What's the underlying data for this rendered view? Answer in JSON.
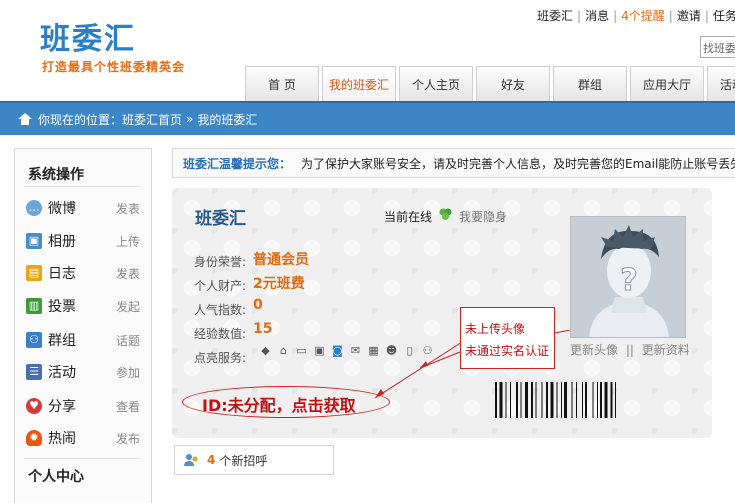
{
  "logo": {
    "title": "班委汇",
    "slogan": "打造最具个性班委精英会"
  },
  "toplinks": {
    "home": "班委汇",
    "messages": "消息",
    "alerts": "4个提醒",
    "invite": "邀请",
    "tasks": "任务"
  },
  "search": {
    "placeholder": "找班委"
  },
  "nav": {
    "tabs": [
      "首 页",
      "我的班委汇",
      "个人主页",
      "好友",
      "群组",
      "应用大厅",
      "活动中心"
    ],
    "active": "我的班委汇"
  },
  "breadcrumb": {
    "prefix": "你现在的位置：",
    "home": "班委汇首页",
    "sep": "»",
    "current": "我的班委汇"
  },
  "sidebar": {
    "section1": "系统操作",
    "items": [
      {
        "label": "微博",
        "action": "发表",
        "icon": "weibo-icon",
        "color": "#6aa7d8"
      },
      {
        "label": "相册",
        "action": "上传",
        "icon": "album-icon",
        "color": "#4c8ac9"
      },
      {
        "label": "日志",
        "action": "发表",
        "icon": "diary-icon",
        "color": "#e8a316"
      },
      {
        "label": "投票",
        "action": "发起",
        "icon": "vote-icon",
        "color": "#3a9b3a"
      },
      {
        "label": "群组",
        "action": "话题",
        "icon": "group-icon",
        "color": "#3a7fc8"
      },
      {
        "label": "活动",
        "action": "参加",
        "icon": "event-icon",
        "color": "#4a6fb0"
      },
      {
        "label": "分享",
        "action": "查看",
        "icon": "share-icon",
        "color": "#d43a3a"
      },
      {
        "label": "热闹",
        "action": "发布",
        "icon": "hot-icon",
        "color": "#e85a14"
      }
    ],
    "section2": "个人中心"
  },
  "notice": {
    "title": "班委汇温馨提示您：",
    "body": "为了保护大家账号安全，请及时完善个人信息，及时完善您的Email能防止账号丢失"
  },
  "profile": {
    "username": "班委汇",
    "online": "当前在线",
    "hide": "我要隐身",
    "fields": [
      {
        "label": "身份荣誉:",
        "value": "普通会员"
      },
      {
        "label": "个人财产:",
        "value": "2元班费"
      },
      {
        "label": "人气指数:",
        "value": "0"
      },
      {
        "label": "经验数值:",
        "value": "15"
      }
    ],
    "services_label": "点亮服务:",
    "id_text": "ID:未分配，点击获取",
    "change_avatar": "更新头像",
    "change_sep": "||",
    "change_profile": "更新资料"
  },
  "annotation": {
    "line1": "未上传头像",
    "line2": "未通过实名认证"
  },
  "new_greetings": {
    "count": "4",
    "label": "个新招呼"
  },
  "colors": {
    "brand": "#2a7fc6",
    "accent": "#e06a10",
    "nav_bar": "#3d86c5",
    "annotation": "#cc2222"
  }
}
